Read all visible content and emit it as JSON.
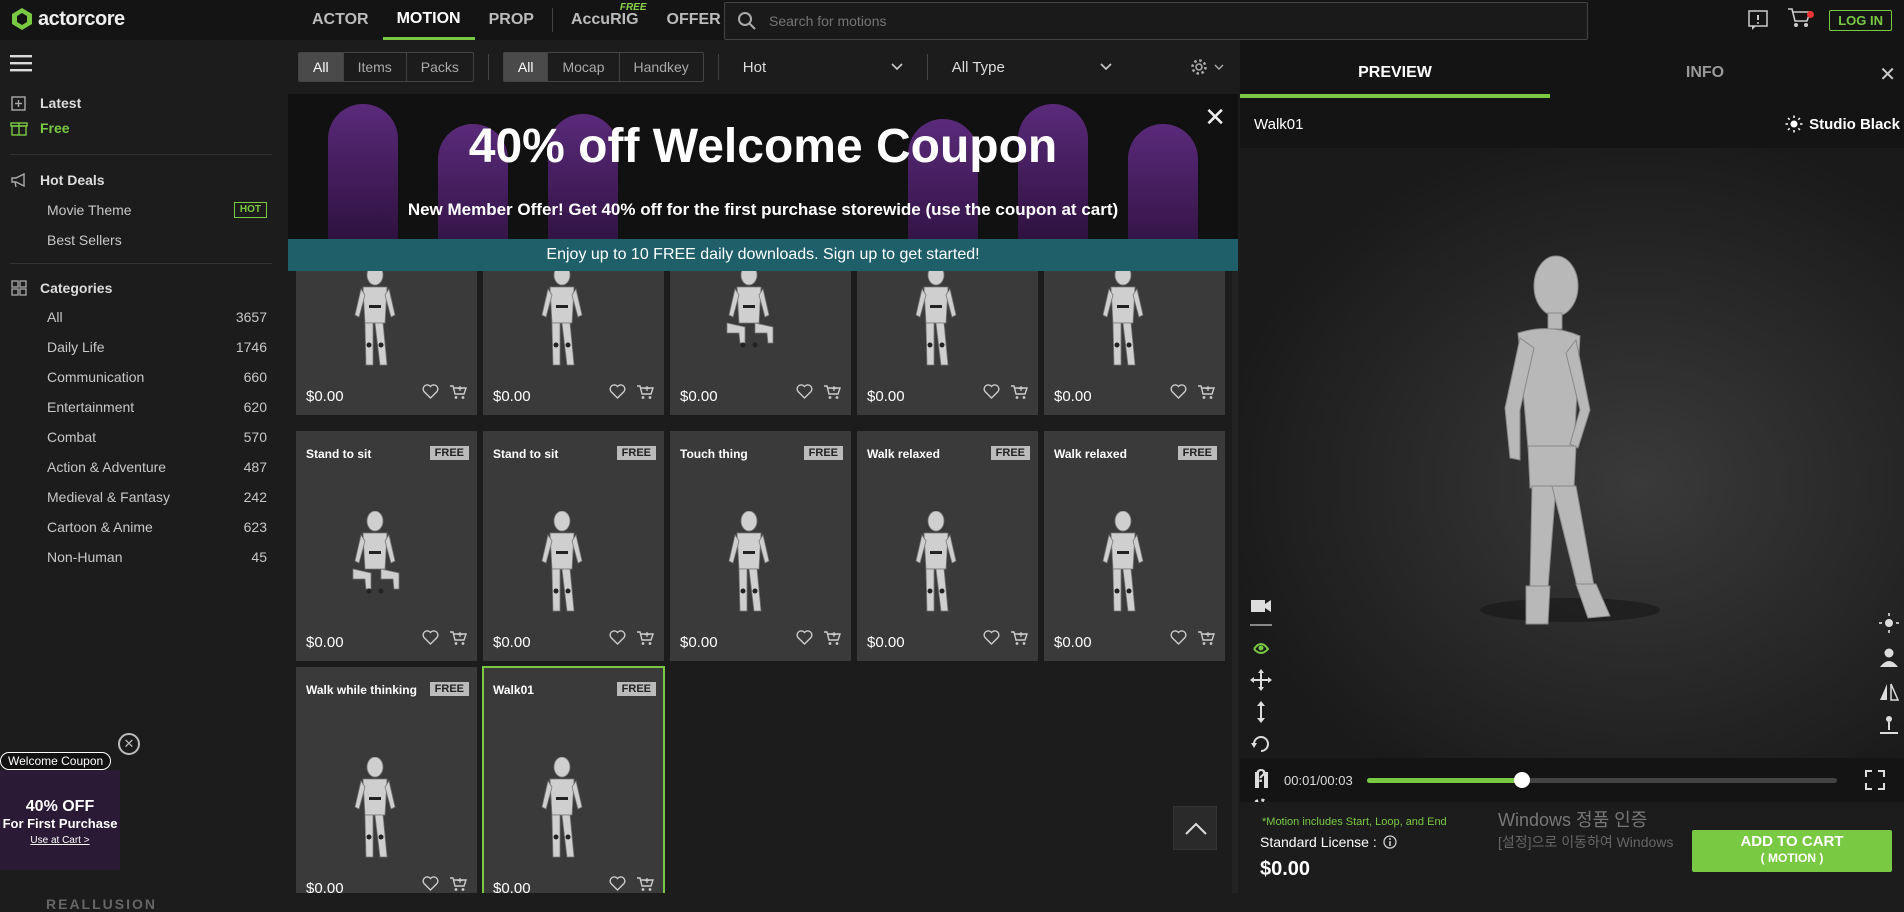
{
  "brand": {
    "logo_text": "actorcore",
    "accent": "#7ac943",
    "footer_logo": "REALLUSION"
  },
  "nav": [
    {
      "label": "ACTOR",
      "active": false
    },
    {
      "label": "MOTION",
      "active": true
    },
    {
      "label": "PROP",
      "active": false
    },
    {
      "label": "AccuRIG",
      "active": false,
      "tag": "FREE"
    },
    {
      "label": "OFFER",
      "active": false
    }
  ],
  "search": {
    "placeholder": "Search for motions"
  },
  "header": {
    "login_label": "LOG IN"
  },
  "sidebar": {
    "latest_label": "Latest",
    "free_label": "Free",
    "hot_deals_label": "Hot Deals",
    "hot_deals_items": [
      {
        "label": "Movie Theme",
        "badge": "HOT"
      },
      {
        "label": "Best Sellers"
      }
    ],
    "categories_label": "Categories",
    "categories": [
      {
        "label": "All",
        "count": "3657"
      },
      {
        "label": "Daily Life",
        "count": "1746"
      },
      {
        "label": "Communication",
        "count": "660"
      },
      {
        "label": "Entertainment",
        "count": "620"
      },
      {
        "label": "Combat",
        "count": "570"
      },
      {
        "label": "Action & Adventure",
        "count": "487"
      },
      {
        "label": "Medieval & Fantasy",
        "count": "242"
      },
      {
        "label": "Cartoon & Anime",
        "count": "623"
      },
      {
        "label": "Non-Human",
        "count": "45"
      }
    ]
  },
  "welcome_popup": {
    "pill": "Welcome Coupon",
    "headline": "40% OFF",
    "subline": "For First Purchase",
    "link": "Use at Cart >"
  },
  "filters": {
    "group1": [
      "All",
      "Items",
      "Packs"
    ],
    "group2": [
      "All",
      "Mocap",
      "Handkey"
    ],
    "sort": "Hot",
    "type": "All Type"
  },
  "banner": {
    "title": "40% off Welcome Coupon",
    "subtitle": "New Member Offer! Get 40% off for the first purchase storewide (use the coupon at cart)"
  },
  "strip": {
    "text": "Enjoy up to 10 FREE daily downloads. Sign up to get started!"
  },
  "cards_row1": [
    {
      "price": "$0.00"
    },
    {
      "price": "$0.00"
    },
    {
      "price": "$0.00"
    },
    {
      "price": "$0.00"
    },
    {
      "price": "$0.00"
    }
  ],
  "cards_row2": [
    {
      "title": "Stand to sit",
      "badge": "FREE",
      "price": "$0.00"
    },
    {
      "title": "Stand to sit",
      "badge": "FREE",
      "price": "$0.00"
    },
    {
      "title": "Touch thing",
      "badge": "FREE",
      "price": "$0.00"
    },
    {
      "title": "Walk relaxed",
      "badge": "FREE",
      "price": "$0.00"
    },
    {
      "title": "Walk relaxed",
      "badge": "FREE",
      "price": "$0.00"
    }
  ],
  "cards_row3": [
    {
      "title": "Walk while thinking",
      "badge": "FREE",
      "price": "$0.00"
    },
    {
      "title": "Walk01",
      "badge": "FREE",
      "price": "$0.00",
      "selected": true
    }
  ],
  "preview": {
    "tabs": [
      "PREVIEW",
      "INFO"
    ],
    "model_name": "Walk01",
    "environment": "Studio Black",
    "time": "00:01/00:03",
    "progress": 0.33,
    "note": "*Motion includes Start, Loop, and End",
    "license_label": "Standard License :",
    "price": "$0.00",
    "add_to_cart": "ADD TO CART",
    "add_to_cart_sub": "( MOTION )"
  },
  "windows_watermark": {
    "line1": "Windows 정품 인증",
    "line2": "[설정]으로 이동하여 Windows"
  }
}
